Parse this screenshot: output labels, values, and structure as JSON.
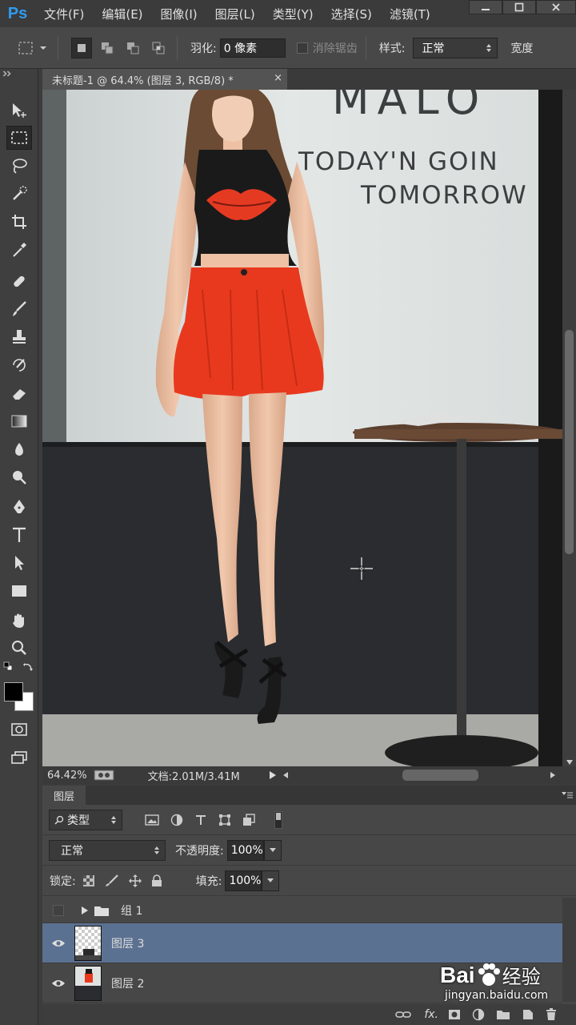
{
  "app": {
    "logo": "Ps"
  },
  "menu": {
    "items": [
      "文件(F)",
      "编辑(E)",
      "图像(I)",
      "图层(L)",
      "类型(Y)",
      "选择(S)",
      "滤镜(T)"
    ]
  },
  "options_bar": {
    "feather_label": "羽化:",
    "feather_value": "0 像素",
    "antialias_label": "消除锯齿",
    "style_label": "样式:",
    "style_value": "正常",
    "width_label": "宽度"
  },
  "document": {
    "tab_title": "未标题-1 @ 64.4% (图层 3, RGB/8) *",
    "zoom": "64.42%",
    "doc_size": "文档:2.01M/3.41M"
  },
  "photo_text": {
    "line1": "MALO",
    "line2": "TODAY'N GOIN",
    "line3": "TOMORROW"
  },
  "layers_panel": {
    "tab_label": "图层",
    "filter_label": "类型",
    "blend_mode": "正常",
    "opacity_label": "不透明度:",
    "opacity_value": "100%",
    "lock_label": "锁定:",
    "fill_label": "填充:",
    "fill_value": "100%",
    "layers": [
      {
        "name": "组 1",
        "type": "group",
        "visible": false,
        "selected": false
      },
      {
        "name": "图层 3",
        "type": "layer",
        "visible": true,
        "selected": true
      },
      {
        "name": "图层 2",
        "type": "layer",
        "visible": true,
        "selected": false
      }
    ],
    "footer_fx": "fx."
  },
  "watermark": {
    "brand": "Bai",
    "brand2": "经验",
    "url": "jingyan.baidu.com"
  },
  "colors": {
    "accent_selected": "#5b7191",
    "ps_blue": "#2f9bf0",
    "skirt_red": "#e8391e"
  }
}
